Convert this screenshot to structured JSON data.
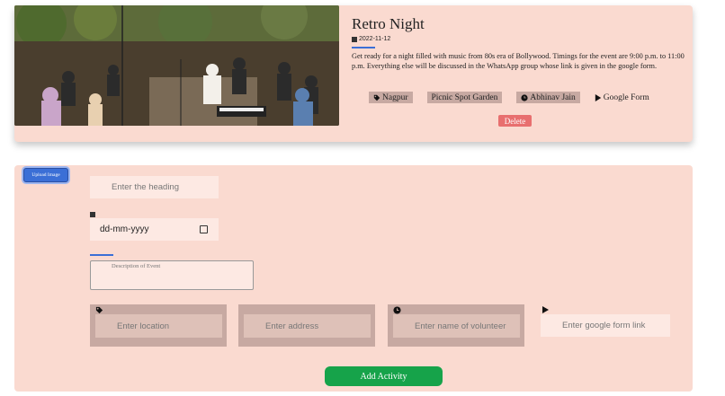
{
  "event": {
    "title": "Retro Night",
    "date": "2022-11-12",
    "description": "Get ready for a night filled with music from 80s era of Bollywood. Timings for the event are 9:00 p.m. to 11:00 p.m. Everything else will be discussed in the WhatsApp group whose link is given in the google form.",
    "tags": [
      {
        "icon": "tag-icon",
        "label": "Nagpur"
      },
      {
        "icon": "none",
        "label": "Picnic Spot Garden"
      },
      {
        "icon": "clock-icon",
        "label": "Abhinav Jain"
      },
      {
        "icon": "play-icon",
        "label": "Google Form"
      }
    ],
    "delete_label": "Delete"
  },
  "form": {
    "upload_label": "Upload Image",
    "heading_placeholder": "Enter the heading",
    "date_placeholder": "dd-mm-yyyy",
    "description_placeholder": "Description of Event",
    "location_placeholder": "Enter location",
    "address_placeholder": "Enter address",
    "volunteer_placeholder": "Enter name of volunteer",
    "link_placeholder": "Enter google form link",
    "add_label": "Add Activity"
  },
  "colors": {
    "card_bg": "#fadad0",
    "accent": "#3b6fd6",
    "delete": "#e86f6f",
    "add": "#16a34a"
  }
}
